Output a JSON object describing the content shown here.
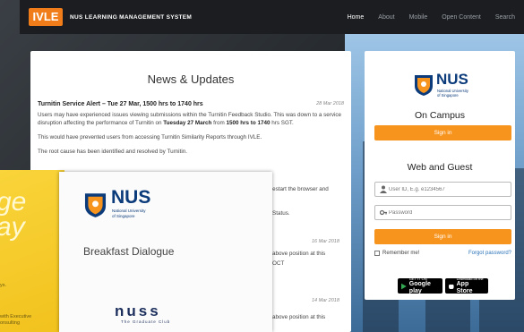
{
  "header": {
    "logo": "IVLE",
    "system_name": "NUS LEARNING MANAGEMENT SYSTEM",
    "nav": [
      "Home",
      "About",
      "Mobile",
      "Open Content",
      "Search"
    ]
  },
  "news": {
    "title": "News & Updates",
    "item1": {
      "headline": "Turnitin Service Alert – Tue 27 Mar, 1500 hrs to 1740 hrs",
      "date": "28 Mar 2018",
      "para1_a": "Users may have experienced issues viewing submissions within the Turnitin Feedback Studio. This was down to a service disruption affecting the performance of Turnitin on ",
      "para1_b": "Tuesday 27 March",
      "para1_c": " from ",
      "para1_d": "1500 hrs to 1740",
      "para1_e": " hrs SGT.",
      "para2": "This would have prevented users from accessing Turnitin Similarity Reports through IVLE.",
      "para3": "The root cause has been identified and resolved by Turnitin."
    },
    "fragments": {
      "restart": "restart the browser and",
      "status": "Status.",
      "date2": "16 Mar 2018",
      "above1": "above position at this",
      "oct": "OCT",
      "date3": "14 Mar 2018",
      "above2": "above position at this"
    }
  },
  "login": {
    "brand": "NUS",
    "brand_sub_1": "National University",
    "brand_sub_2": "of Singapore",
    "on_campus": "On Campus",
    "signin_campus": "Sign in",
    "web_guest": "Web and Guest",
    "userid_placeholder": "User ID, E.g. e1234567",
    "password_placeholder": "Password",
    "signin_guest": "Sign in",
    "remember": "Remember me!",
    "forgot": "Forgot password?",
    "google_small": "GET IT ON",
    "google_big": "Google play",
    "apple_small": "Download on the",
    "apple_big": "App Store"
  },
  "brochure": {
    "big_1": "ge",
    "big_2": "ay",
    "snippet_1": "ys.",
    "snippet_2": "with Executive",
    "snippet_3": "onsulting",
    "nus": "NUS",
    "sub_1": "National University",
    "sub_2": "of Singapore",
    "title": "Breakfast Dialogue",
    "nuss": "nuss",
    "nuss_sub": "The Graduate Club"
  },
  "colors": {
    "accent": "#f7941d",
    "brand_blue": "#0b3b7a",
    "link": "#2b73b8"
  }
}
